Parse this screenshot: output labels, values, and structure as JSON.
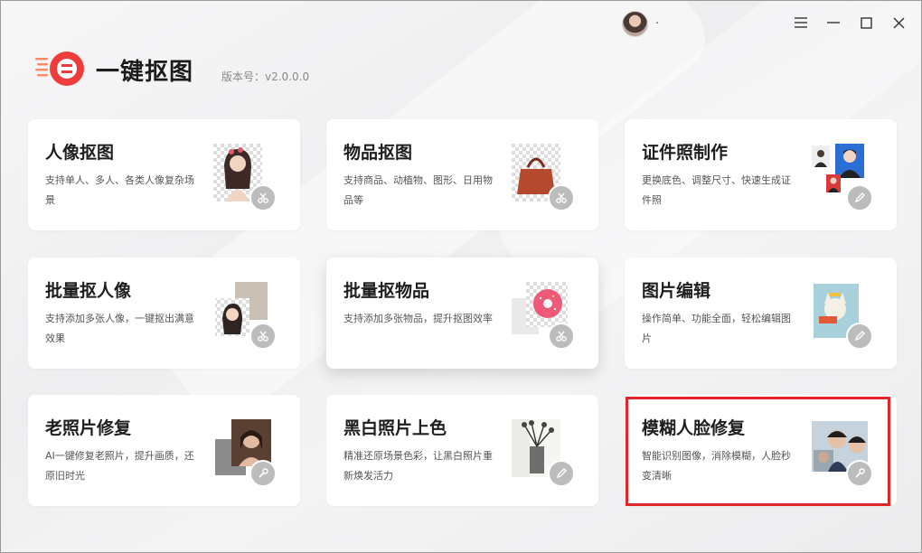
{
  "header": {
    "username": ".",
    "app_title": "一键抠图",
    "version": "版本号：v2.0.0.0"
  },
  "window_controls": [
    "menu-icon",
    "minimize-icon",
    "maximize-icon",
    "close-icon"
  ],
  "colors": {
    "logo_red": "#ee3b3b",
    "logo_accent": "#ff8a66",
    "highlight_red": "#e0262b",
    "badge_gray": "#bcbcbc"
  },
  "cards": [
    {
      "title": "人像抠图",
      "desc": "支持单人、多人、各类人像复杂场景",
      "badge_icon": "scissors-icon"
    },
    {
      "title": "物品抠图",
      "desc": "支持商品、动植物、图形、日用物品等",
      "badge_icon": "scissors-icon"
    },
    {
      "title": "证件照制作",
      "desc": "更换底色、调整尺寸、快速生成证件照",
      "badge_icon": "pencil-icon"
    },
    {
      "title": "批量抠人像",
      "desc": "支持添加多张人像，一键抠出满意效果",
      "badge_icon": "scissors-icon"
    },
    {
      "title": "批量抠物品",
      "desc": "支持添加多张物品，提升抠图效率",
      "badge_icon": "scissors-icon"
    },
    {
      "title": "图片编辑",
      "desc": "操作简单、功能全面，轻松编辑图片",
      "badge_icon": "pencil-icon"
    },
    {
      "title": "老照片修复",
      "desc": "AI一键修复老照片，提升画质，还原旧时光",
      "badge_icon": "wrench-icon"
    },
    {
      "title": "黑白照片上色",
      "desc": "精准还原场景色彩，让黑白照片重新焕发活力",
      "badge_icon": "pencil-icon"
    },
    {
      "title": "模糊人脸修复",
      "desc": "智能识别图像，消除模糊，人脸秒变清晰",
      "badge_icon": "wrench-icon"
    }
  ]
}
